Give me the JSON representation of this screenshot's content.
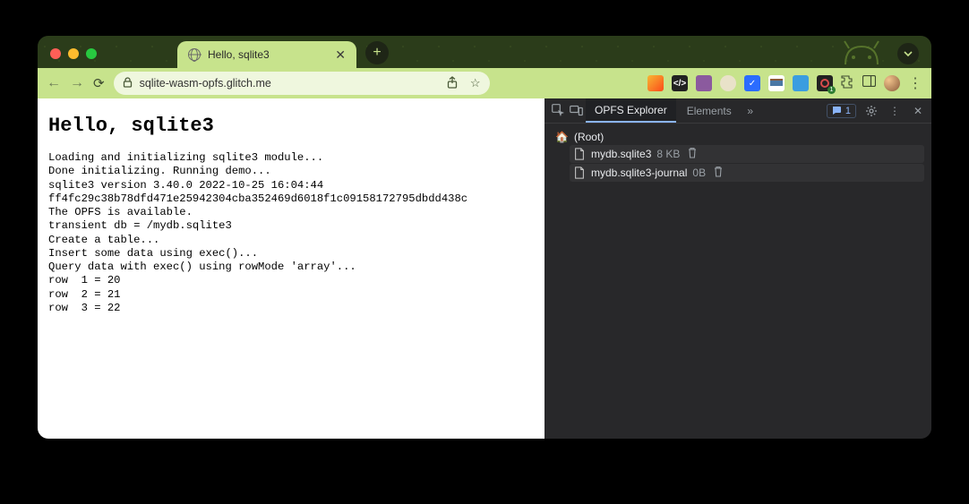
{
  "window": {
    "tab_title": "Hello, sqlite3",
    "url": "sqlite-wasm-opfs.glitch.me"
  },
  "page": {
    "heading": "Hello, sqlite3",
    "log": "Loading and initializing sqlite3 module...\nDone initializing. Running demo...\nsqlite3 version 3.40.0 2022-10-25 16:04:44\nff4fc29c38b78dfd471e25942304cba352469d6018f1c09158172795dbdd438c\nThe OPFS is available.\ntransient db = /mydb.sqlite3\nCreate a table...\nInsert some data using exec()...\nQuery data with exec() using rowMode 'array'...\nrow  1 = 20\nrow  2 = 21\nrow  3 = 22"
  },
  "devtools": {
    "tabs": {
      "opfs": "OPFS Explorer",
      "elements": "Elements"
    },
    "issues_count": "1",
    "tree": {
      "root_label": "(Root)",
      "files": [
        {
          "name": "mydb.sqlite3",
          "size": "8 KB"
        },
        {
          "name": "mydb.sqlite3-journal",
          "size": "0B"
        }
      ]
    }
  }
}
